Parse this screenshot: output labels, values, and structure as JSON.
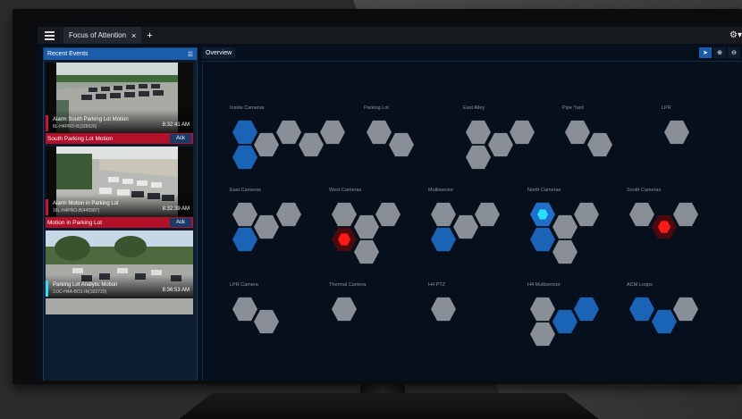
{
  "app": {
    "tab_title": "Focus of Attention",
    "tab_close": "×",
    "tab_add": "+",
    "settings_icon": "gear-icon",
    "settings_glyph": "⚙▾"
  },
  "recent_events": {
    "title": "Recent Events",
    "filter_icon": "sliders-icon",
    "items": [
      {
        "title": "Alarm South Parking Lot Motion",
        "subtitle": "8L-H4PRO-B(328626)",
        "time": "8:32:41 AM",
        "strip_label": "South Parking Lot Motion",
        "ack": "Ack",
        "color": "#d01030"
      },
      {
        "title": "Alarm Motion in Parking Lot",
        "subtitle": "16L-H4PRO-B(445587)",
        "time": "8:32:39 AM",
        "strip_label": "Motion in Parking Lot",
        "ack": "Ack",
        "color": "#d01030"
      },
      {
        "title": "Parking Lot Analytic Motion",
        "subtitle": "3.0C-H4A-BO1-IR(302720)",
        "time": "8:36:53 AM",
        "color": "#28e0ff"
      }
    ]
  },
  "overview": {
    "tab_label": "Overview",
    "tools": [
      "pointer-icon",
      "zoom-in-icon",
      "zoom-out-icon",
      "hand-icon"
    ],
    "tool_glyphs": [
      "➤",
      "⊕",
      "⊖",
      "✋"
    ],
    "groups": [
      "Inside Cameras",
      "Parking Lot",
      "East Alley",
      "Pipe Yard",
      "LPR",
      "East Cameras",
      "West Cameras",
      "Multisensor",
      "North Cameras",
      "South Cameras",
      "LPR Camera",
      "Thermal Camera",
      "H4 PTZ",
      "H4 Multisensor",
      "ACM Loops"
    ]
  }
}
